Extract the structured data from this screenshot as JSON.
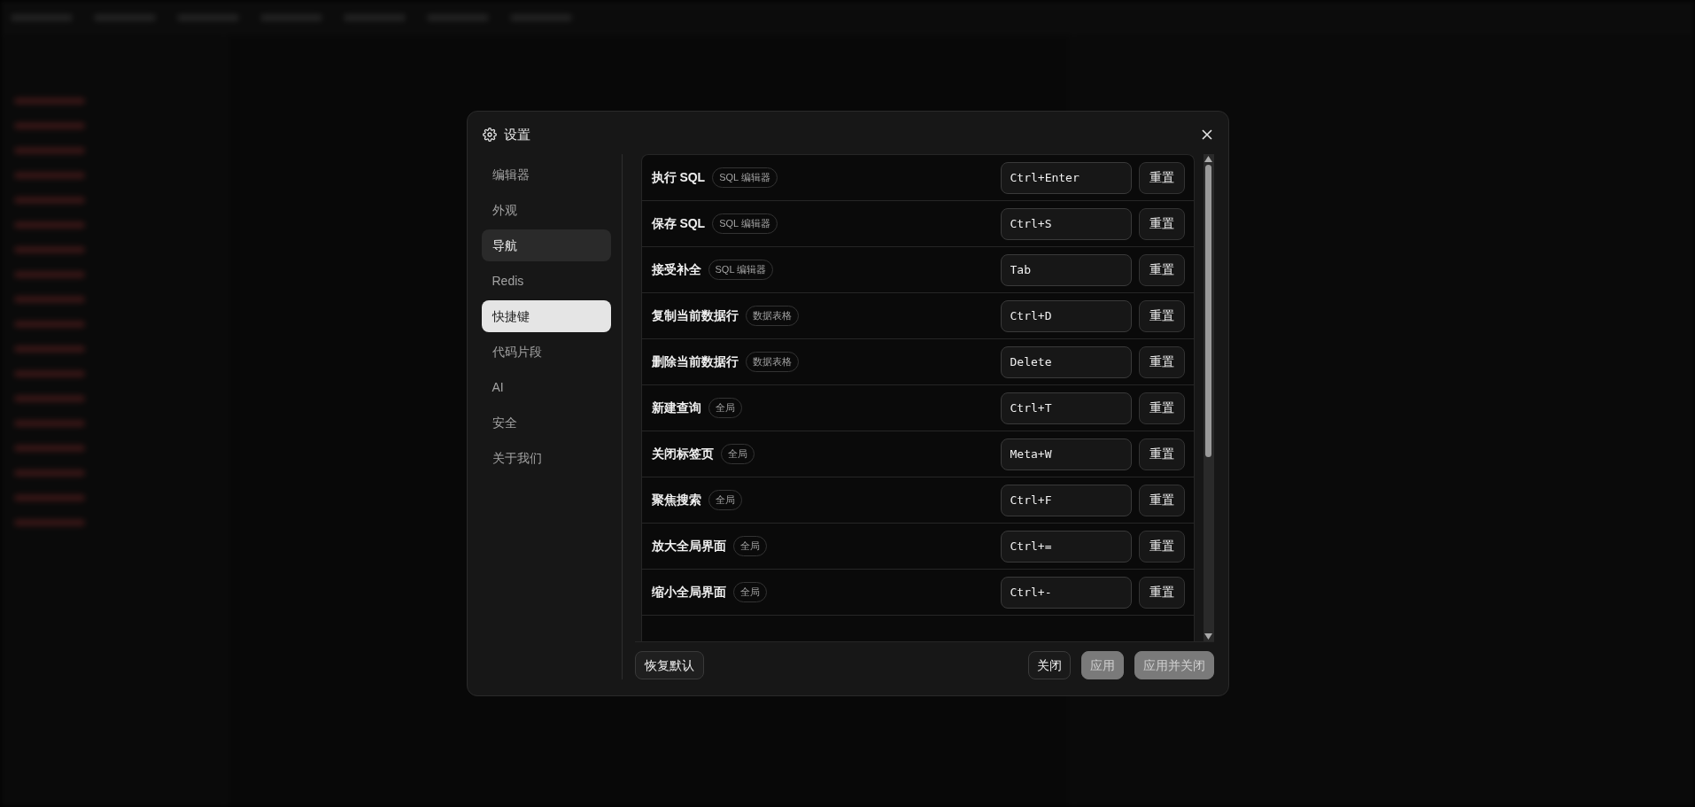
{
  "dialog": {
    "title": "设置",
    "nav": [
      {
        "label": "编辑器",
        "selected": false,
        "hovered": false
      },
      {
        "label": "外观",
        "selected": false,
        "hovered": false
      },
      {
        "label": "导航",
        "selected": false,
        "hovered": true
      },
      {
        "label": "Redis",
        "selected": false,
        "hovered": false
      },
      {
        "label": "快捷键",
        "selected": true,
        "hovered": false
      },
      {
        "label": "代码片段",
        "selected": false,
        "hovered": false
      },
      {
        "label": "AI",
        "selected": false,
        "hovered": false
      },
      {
        "label": "安全",
        "selected": false,
        "hovered": false
      },
      {
        "label": "关于我们",
        "selected": false,
        "hovered": false
      }
    ],
    "shortcuts": [
      {
        "name": "执行 SQL",
        "scope": "SQL 编辑器",
        "keys": "Ctrl+Enter",
        "reset": "重置"
      },
      {
        "name": "保存 SQL",
        "scope": "SQL 编辑器",
        "keys": "Ctrl+S",
        "reset": "重置"
      },
      {
        "name": "接受补全",
        "scope": "SQL 编辑器",
        "keys": "Tab",
        "reset": "重置"
      },
      {
        "name": "复制当前数据行",
        "scope": "数据表格",
        "keys": "Ctrl+D",
        "reset": "重置"
      },
      {
        "name": "删除当前数据行",
        "scope": "数据表格",
        "keys": "Delete",
        "reset": "重置"
      },
      {
        "name": "新建查询",
        "scope": "全局",
        "keys": "Ctrl+T",
        "reset": "重置"
      },
      {
        "name": "关闭标签页",
        "scope": "全局",
        "keys": "Meta+W",
        "reset": "重置"
      },
      {
        "name": "聚焦搜索",
        "scope": "全局",
        "keys": "Ctrl+F",
        "reset": "重置"
      },
      {
        "name": "放大全局界面",
        "scope": "全局",
        "keys": "Ctrl+=",
        "reset": "重置"
      },
      {
        "name": "缩小全局界面",
        "scope": "全局",
        "keys": "Ctrl+-",
        "reset": "重置"
      }
    ],
    "footer": {
      "restore": {
        "label": "恢复默认",
        "disabled": false
      },
      "buttons": [
        {
          "label": "关闭",
          "disabled": false
        },
        {
          "label": "应用",
          "disabled": true
        },
        {
          "label": "应用并关闭",
          "disabled": true
        }
      ]
    }
  }
}
